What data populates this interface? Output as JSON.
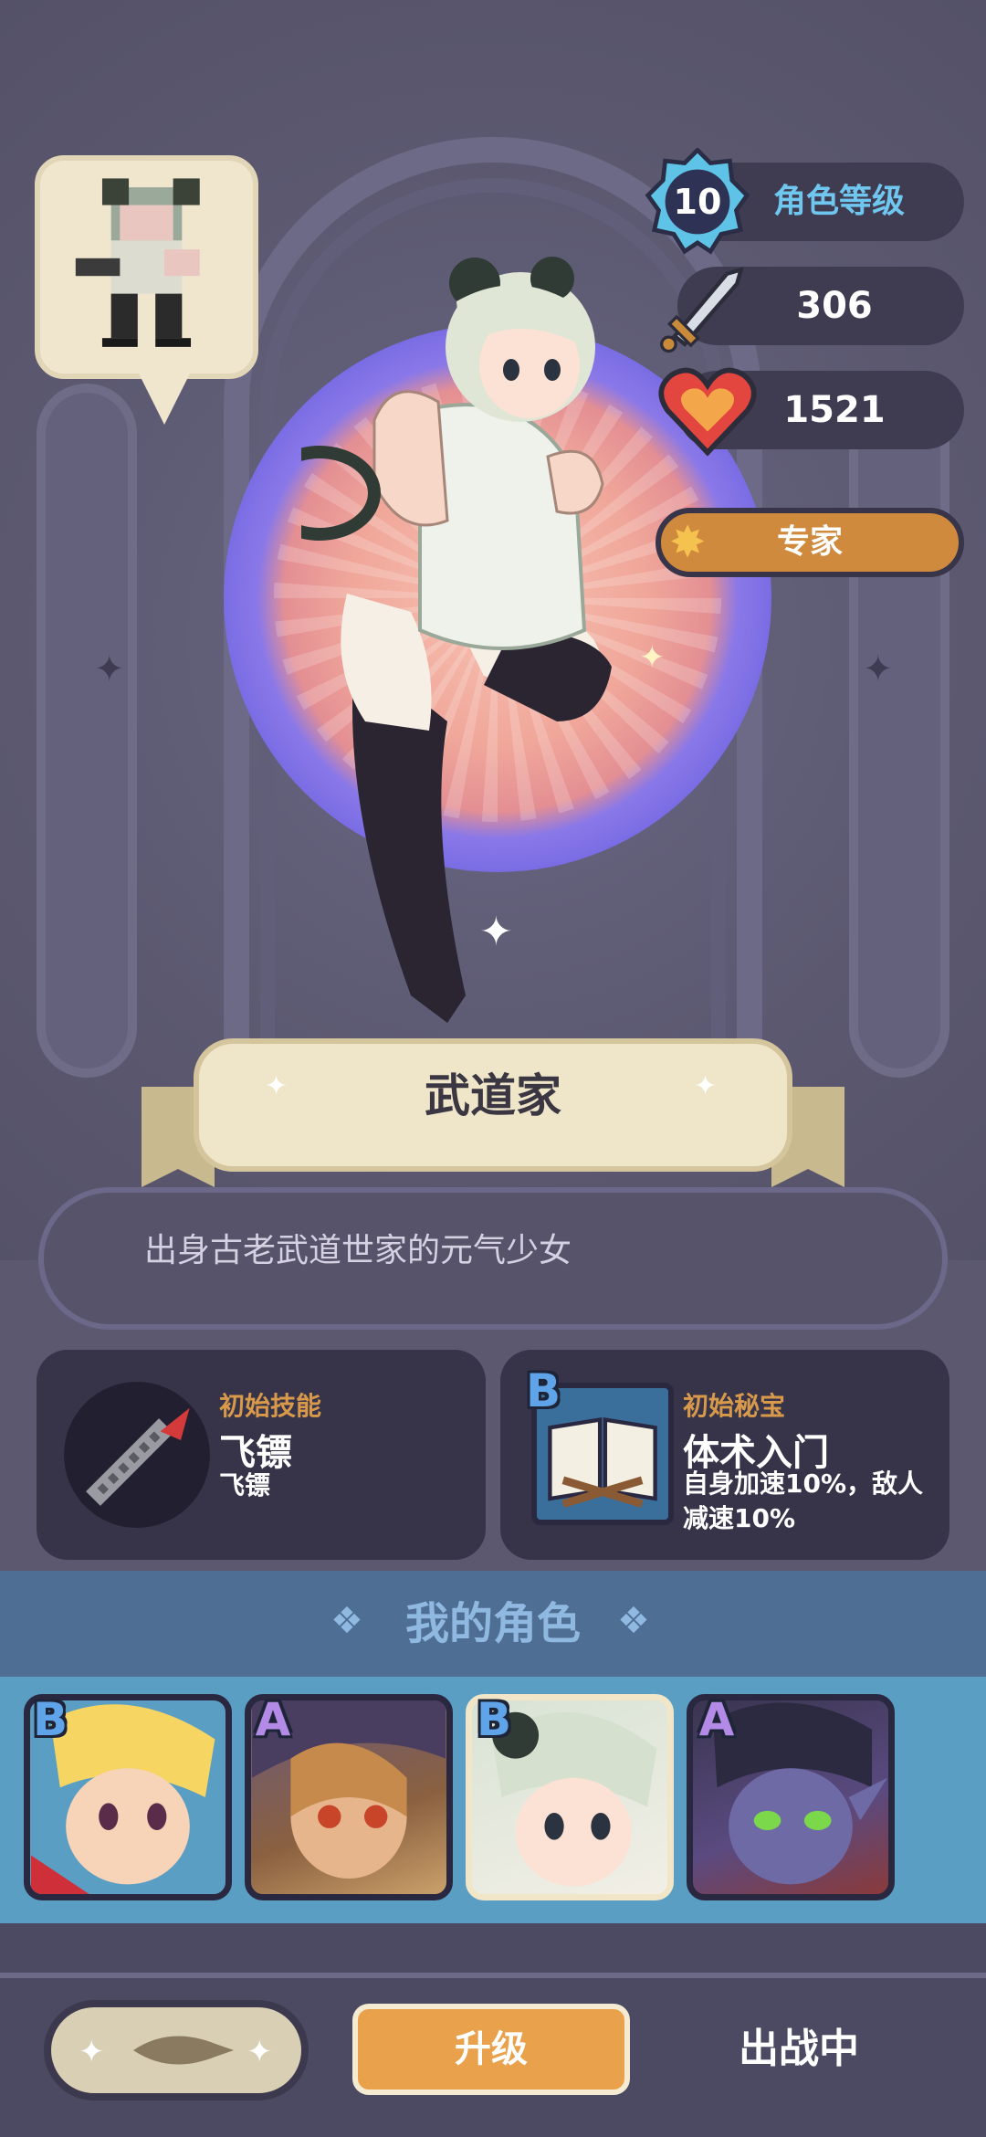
{
  "hero": {
    "level": "10",
    "level_label": "角色等级",
    "attack": "306",
    "health": "1521",
    "rank": "专家",
    "name": "武道家",
    "description": "出身古老武道世家的元气少女"
  },
  "skill_card": {
    "label": "初始技能",
    "title": "飞镖",
    "sub": "飞镖"
  },
  "treasure_card": {
    "grade": "B",
    "label": "初始秘宝",
    "title": "体术入门",
    "sub": "自身加速10%，敌人减速10%"
  },
  "my_characters": {
    "title": "我的角色",
    "items": [
      {
        "grade": "B",
        "icon": "blonde-hero-portrait"
      },
      {
        "grade": "A",
        "icon": "hooded-girl-portrait"
      },
      {
        "grade": "B",
        "icon": "martial-artist-portrait",
        "selected": true
      },
      {
        "grade": "A",
        "icon": "demon-boy-portrait"
      }
    ]
  },
  "footer": {
    "upgrade_label": "升级",
    "status_label": "出战中"
  },
  "colors": {
    "accent_orange": "#e9a24b",
    "level_blue": "#5fc3e8",
    "grade_b": "#5fa4e8",
    "grade_a": "#b38be6"
  }
}
